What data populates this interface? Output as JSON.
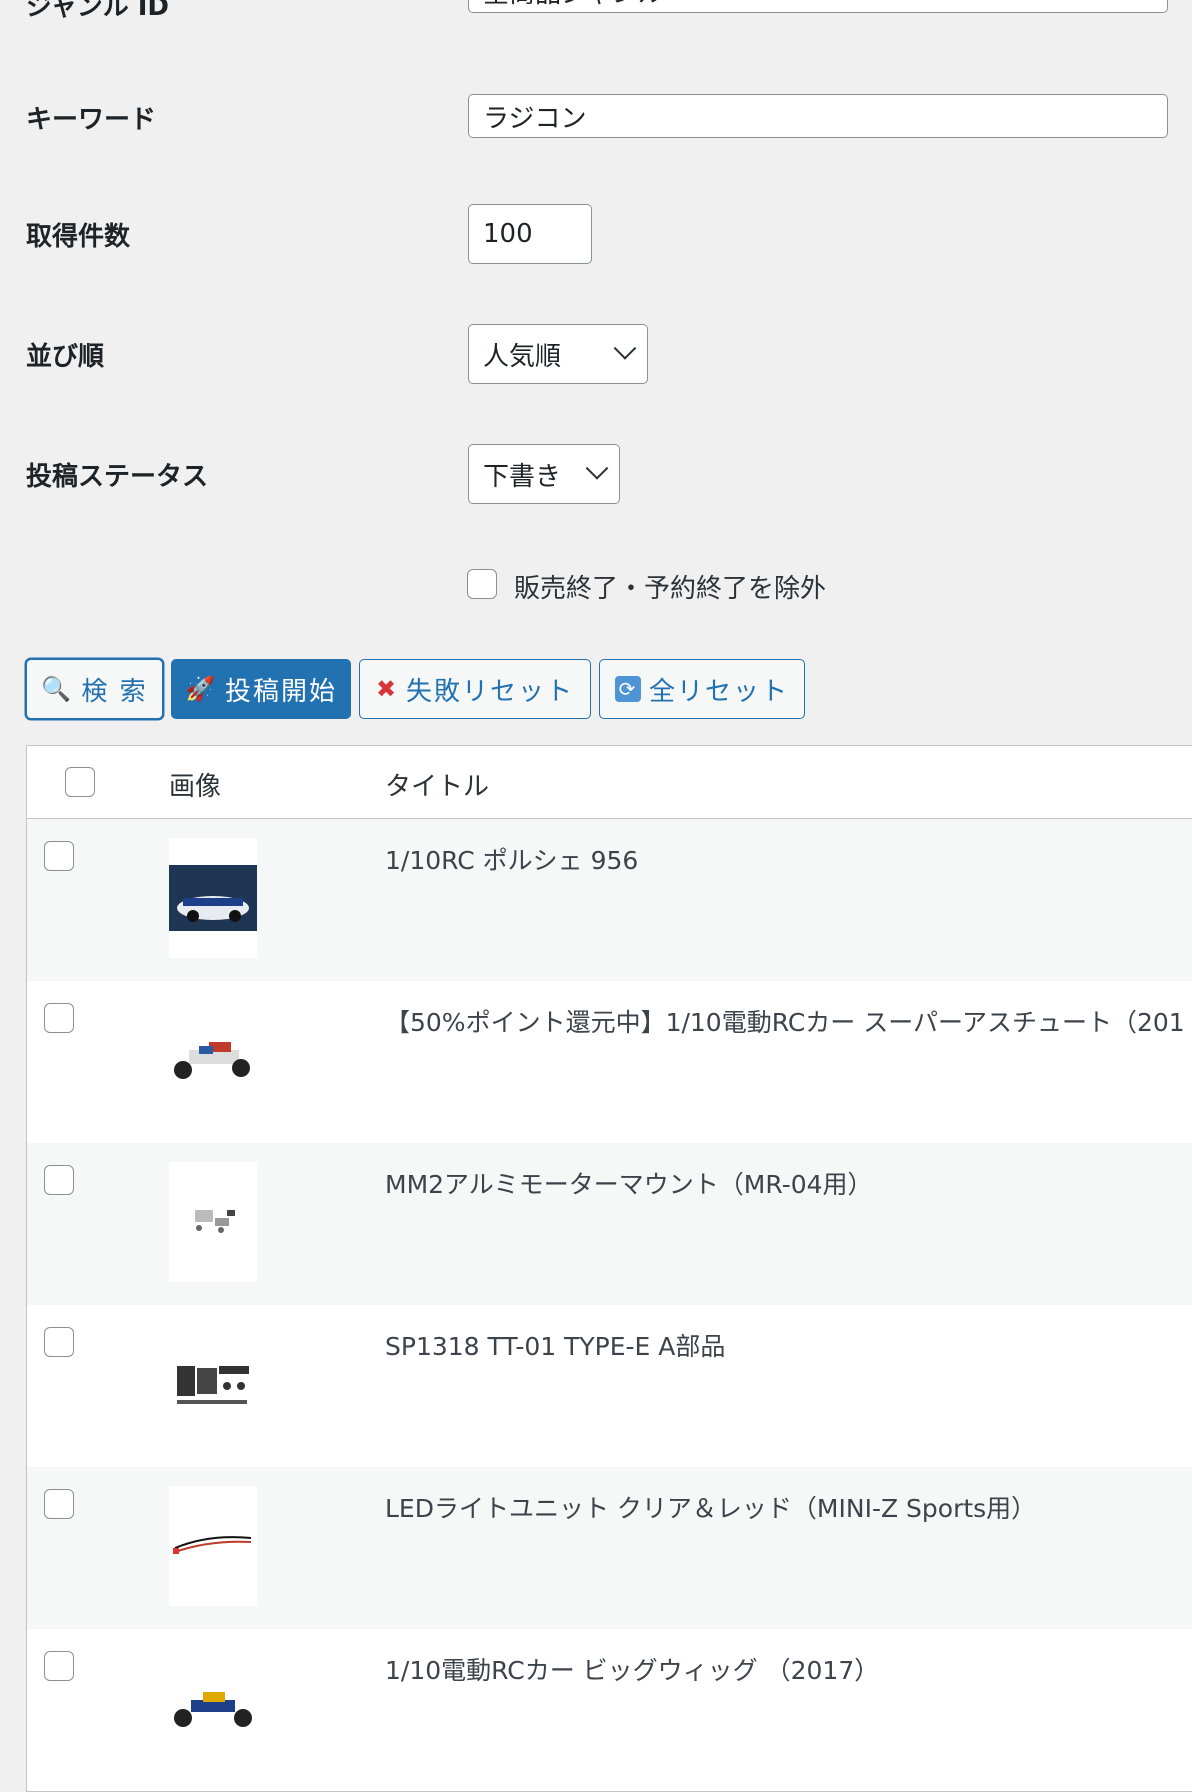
{
  "form": {
    "top_label": "ジャンル ID",
    "top_value": "全商品ジャンル",
    "keyword_label": "キーワード",
    "keyword_value": "ラジコン",
    "count_label": "取得件数",
    "count_value": "100",
    "sort_label": "並び順",
    "sort_value": "人気順",
    "status_label": "投稿ステータス",
    "status_value": "下書き",
    "exclude_label": "販売終了・予約終了を除外"
  },
  "buttons": {
    "search": "検 索",
    "post": "投稿開始",
    "fail_reset": "失敗リセット",
    "all_reset": "全リセット"
  },
  "table": {
    "col_image": "画像",
    "col_title": "タイトル",
    "rows": [
      {
        "title": "1/10RC ポルシェ 956"
      },
      {
        "title": "【50%ポイント還元中】1/10電動RCカー スーパーアスチュート（201"
      },
      {
        "title": "MM2アルミモーターマウント（MR-04用）"
      },
      {
        "title": "SP1318 TT-01 TYPE-E A部品"
      },
      {
        "title": "LEDライトユニット クリア＆レッド（MINI-Z Sports用）"
      },
      {
        "title": "1/10電動RCカー ビッグウィッグ （2017）"
      }
    ]
  },
  "colors": {
    "accent": "#2271b1",
    "danger": "#d63638"
  }
}
